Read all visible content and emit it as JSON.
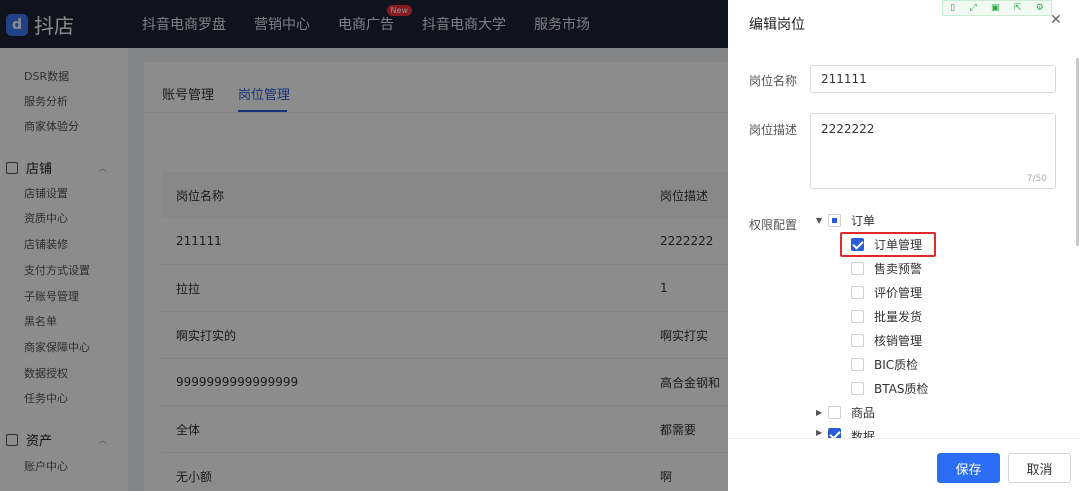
{
  "brand": {
    "logo_glyph": "d",
    "name": "抖店"
  },
  "top_nav": {
    "items": [
      "抖音电商罗盘",
      "营销中心",
      "电商广告",
      "抖音电商大学",
      "服务市场"
    ],
    "badge": "New"
  },
  "sidebar": {
    "top_items": [
      "DSR数据",
      "服务分析",
      "商家体验分"
    ],
    "section_store": "店铺",
    "store_items": [
      "店铺设置",
      "资质中心",
      "店铺装修",
      "支付方式设置",
      "子账号管理",
      "黑名单",
      "商家保障中心",
      "数据授权",
      "任务中心"
    ],
    "section_assets": "资产",
    "asset_items": [
      "账户中心"
    ]
  },
  "main": {
    "tabs": [
      "账号管理",
      "岗位管理"
    ],
    "active_tab": "岗位管理",
    "columns": [
      "岗位名称",
      "岗位描述"
    ],
    "rows": [
      {
        "name": "211111",
        "desc": "2222222"
      },
      {
        "name": "拉拉",
        "desc": "1"
      },
      {
        "name": "啊实打实的",
        "desc": "啊实打实"
      },
      {
        "name": "9999999999999999",
        "desc": "高合金钢和"
      },
      {
        "name": "全体",
        "desc": "都需要"
      },
      {
        "name": "无小额",
        "desc": "啊"
      }
    ]
  },
  "drawer": {
    "title": "编辑岗位",
    "close_icon": "close-icon",
    "name_label": "岗位名称",
    "name_value": "211111",
    "desc_label": "岗位描述",
    "desc_value": "2222222",
    "desc_counter": "7/50",
    "perm_label": "权限配置",
    "tree": {
      "order": {
        "label": "订单",
        "state": "indeterminate"
      },
      "order_children": [
        {
          "label": "订单管理",
          "checked": true,
          "highlighted": true
        },
        {
          "label": "售卖预警",
          "checked": false
        },
        {
          "label": "评价管理",
          "checked": false
        },
        {
          "label": "批量发货",
          "checked": false
        },
        {
          "label": "核销管理",
          "checked": false
        },
        {
          "label": "BIC质检",
          "checked": false
        },
        {
          "label": "BTAS质检",
          "checked": false
        }
      ],
      "goods": {
        "label": "商品",
        "checked": false
      },
      "data": {
        "label": "数据",
        "checked": true
      }
    },
    "save_label": "保存",
    "cancel_label": "取消"
  },
  "colors": {
    "primary": "#2b6df5",
    "highlight": "#e02b2b",
    "topbar": "#1f2433"
  }
}
